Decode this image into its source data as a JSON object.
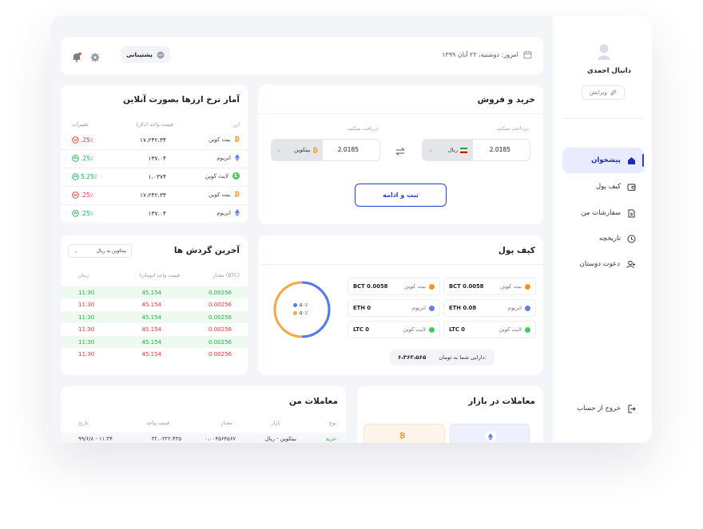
{
  "topbar": {
    "date": "امروز: دوشنبه، ۲۲ آبان ۱۳۹۹",
    "support_label": "پشتیبانی"
  },
  "profile": {
    "name": "دانیال احمدی",
    "edit_label": "ویرایش"
  },
  "nav": {
    "dashboard": "پیشخوان",
    "wallet": "کیف پول",
    "orders": "سفارشات من",
    "history": "تاریخچه",
    "invite": "دعوت دوستان",
    "logout": "خروج از حساب"
  },
  "trade": {
    "title": "خرید و فروش",
    "pay_label": "پرداخت میکنید:",
    "receive_label": "دریافت میکنید:",
    "pay_value": "2.0185",
    "pay_currency": "ریال",
    "receive_value": "2.0185",
    "receive_currency": "بیتکوین",
    "submit_label": "ثبت و ادامه"
  },
  "rates": {
    "title": "آمار نرخ ارزها بصورت آنلاین",
    "col_currency": "ارز",
    "col_price": "قیمت واحد (دلار)",
    "col_change": "تغییرات",
    "rows": [
      {
        "name": "بیت کوین",
        "price": "۱۷،۲۴۲،۳۴",
        "change": ".25٪",
        "dir": "down",
        "coin": "btc"
      },
      {
        "name": "اتریوم",
        "price": "۱۳۷،۰۴",
        "change": ".25٪",
        "dir": "up",
        "coin": "eth"
      },
      {
        "name": "لایت کوین",
        "price": "۱،۰۳۷۴",
        "change": "5.25٪",
        "dir": "up",
        "coin": "ltc"
      },
      {
        "name": "بیت کوین",
        "price": "۱۷،۲۴۲،۳۴",
        "change": ".25٪",
        "dir": "down",
        "coin": "btc"
      },
      {
        "name": "اتریوم",
        "price": "۱۳۷،۰۴",
        "change": ".25٪",
        "dir": "up",
        "coin": "eth"
      }
    ]
  },
  "wallet": {
    "title": "کیف پول",
    "items": [
      {
        "name": "بیت کوین",
        "value": "BCT 0.0058",
        "coin": "btc"
      },
      {
        "name": "اتریوم",
        "value": "ETH 0.08",
        "coin": "eth"
      },
      {
        "name": "لایت کوین",
        "value": "LTC 0",
        "coin": "ltc"
      },
      {
        "name": "بیت کوین",
        "value": "BCT 0.0058",
        "coin": "btc"
      },
      {
        "name": "اتریوم",
        "value": "ETH 0",
        "coin": "eth"
      },
      {
        "name": "لایت کوین",
        "value": "LTC 0",
        "coin": "ltc"
      }
    ],
    "balance_label": "دارایی شما به تومان:",
    "balance_value": "۶،۳۶۳،۵۶۵",
    "donut_blue_label": "۵۰٪",
    "donut_orange_label": "۵۰٪",
    "donut_blue_fraction": 0.5
  },
  "last_turnover": {
    "title": "آخرین گردش ها",
    "filter": "بیتکوین به ریال",
    "col_amount": "مقدار (BTC)",
    "col_price": "قیمت واحد (تومان)",
    "col_time": "زمان",
    "rows": [
      {
        "amount": "0.00256",
        "price": "45.154",
        "time": "11:30",
        "dir": "up"
      },
      {
        "amount": "0.00256",
        "price": "45.154",
        "time": "11:30",
        "dir": "down"
      },
      {
        "amount": "0.00256",
        "price": "45.154",
        "time": "11:30",
        "dir": "up"
      },
      {
        "amount": "0.00256",
        "price": "45.154",
        "time": "11:30",
        "dir": "down"
      },
      {
        "amount": "0.00256",
        "price": "45.154",
        "time": "11:30",
        "dir": "up"
      },
      {
        "amount": "0.00256",
        "price": "45.154",
        "time": "11:30",
        "dir": "down"
      }
    ]
  },
  "my_trades": {
    "title": "معاملات من",
    "col_type": "نوع",
    "col_market": "بازار",
    "col_amount": "مقدار",
    "col_price": "قیمت واحد",
    "col_date": "تاریخ",
    "row": {
      "type": "خرید",
      "market": "بیتکوین - ریال",
      "amount": "۰،۰۰۴۵۶۴۵۶۷",
      "price": "۳۲،۰۳۲۲،۴۳۵",
      "date": "۹۹/۶/۸ - ۱۱:۳۴"
    }
  },
  "market_trades": {
    "title": "معاملات در بازار"
  },
  "colors": {
    "accent": "#2b3bd6",
    "accent_light": "#e9ecff",
    "btc": "#f7931a",
    "eth": "#627eea",
    "ltc": "#3ecf5a",
    "up": "#1db34a",
    "down": "#e33"
  }
}
